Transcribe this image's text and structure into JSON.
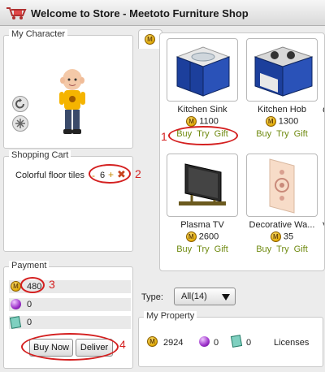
{
  "window": {
    "title": "Welcome to Store - Meetoto Furniture Shop"
  },
  "character": {
    "legend": "My Character"
  },
  "cart": {
    "legend": "Shopping Cart",
    "item_name": "Colorful floor tiles",
    "minus": "-",
    "quantity": "6",
    "plus": "+",
    "remove": "✖"
  },
  "payment": {
    "legend": "Payment",
    "coins_value": "480",
    "gems_value": "0",
    "licenses_value": "0",
    "buy_now_label": "Buy Now",
    "deliver_label": "Deliver"
  },
  "store": {
    "items": [
      {
        "name": "Kitchen Sink",
        "price": "1100",
        "buy": "Buy",
        "try": "Try",
        "gift": "Gift"
      },
      {
        "name": "Kitchen Hob",
        "price": "1300",
        "buy": "Buy",
        "try": "Try",
        "gift": "Gift"
      },
      {
        "name": "Plasma TV",
        "price": "2600",
        "buy": "Buy",
        "try": "Try",
        "gift": "Gift"
      },
      {
        "name": "Decorative Wa...",
        "price": "35",
        "buy": "Buy",
        "try": "Try",
        "gift": "Gift"
      }
    ],
    "partial_col_letters": [
      "C",
      "V"
    ]
  },
  "type_filter": {
    "label": "Type:",
    "selected": "All(14)"
  },
  "property": {
    "legend": "My Property",
    "coins": "2924",
    "gems": "0",
    "licenses_count": "0",
    "licenses_label": "Licenses"
  },
  "annotations": {
    "n1": "1",
    "n2": "2",
    "n3": "3",
    "n4": "4"
  },
  "colors": {
    "annotation_red": "#d42020",
    "action_green": "#6f8a10",
    "coin_gold": "#e0a800"
  }
}
